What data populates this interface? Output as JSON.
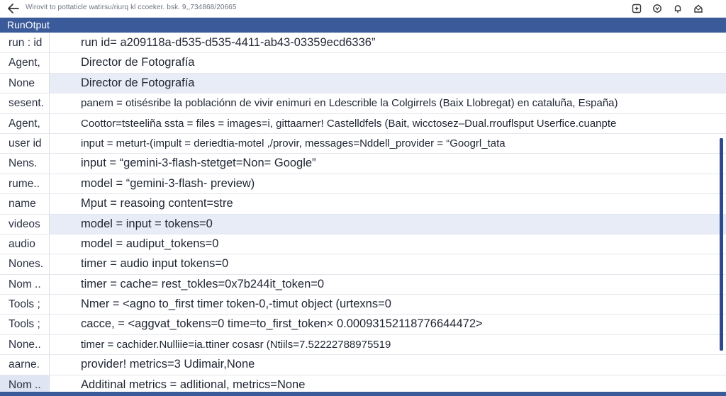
{
  "header": {
    "url": "Wirovit to pottaticle watirsu/riurq kl ccoeker. bsk. 9,,734868/20665",
    "icons": [
      "save-icon",
      "settings-icon",
      "bell-icon",
      "home-icon"
    ]
  },
  "panel": {
    "title": "RunOtput"
  },
  "rows": [
    {
      "key": "run : id",
      "value": "run id= a209118a-d535-d535-4411-ab43-03359ecd6336”"
    },
    {
      "key": "Agent,",
      "value": "Director de Fotografía"
    },
    {
      "key": "None",
      "value": "Director de Fotografía"
    },
    {
      "key": "sesent.",
      "value": "panem = otisésribe la poblaciónn de vivir enimuri en Ldescrible la Colgirrels (Baix Llobregat) en cataluña, España)"
    },
    {
      "key": "Agent,",
      "value": "Coottor=tsteeliña ssta = files = images=i, gittaarner! Castelldfels (Bait, wicctosez–Dual.rrouflsput Userfice.cuanpte"
    },
    {
      "key": "user id",
      "value": "input = meturt-(impult = deriedtia-motel ,/provir, messages=Nddell_provider = “Googrl_tata"
    },
    {
      "key": "Nens.",
      "value": "input = “gemini-3-flash-stetget=Non= Google”"
    },
    {
      "key": "rume..",
      "value": "model = “gemini-3-flash- preview)"
    },
    {
      "key": "name",
      "value": "Mput = reasoing content=stre"
    },
    {
      "key": "videos",
      "value": "model = input = tokens=0"
    },
    {
      "key": "audio",
      "value": "model = audiput_tokens=0"
    },
    {
      "key": "Nones.",
      "value": "timer = audio input tokens=0"
    },
    {
      "key": "Nom ..",
      "value": "timer = cache= rest_tokles=0x7b244it_token=0"
    },
    {
      "key": "Tools ;",
      "value": "Nmer = <agno to_first timer token-0,-timut object (urtexns=0"
    },
    {
      "key": "Tools ;",
      "value": "cacce, = <aggvat_tokens=0 time=to_first_token× 0.00093152118776644472>"
    },
    {
      "key": "None..",
      "value": "timer = cachider.Nulliie=ia.ttiner cosasr (Ntiils=7.52222788975519"
    },
    {
      "key": "aarne.",
      "value": "provider! metrics=3 Udimair,None"
    },
    {
      "key": "Nom ..",
      "value": "Additinal metrics = adlitional, metrics=None"
    }
  ]
}
